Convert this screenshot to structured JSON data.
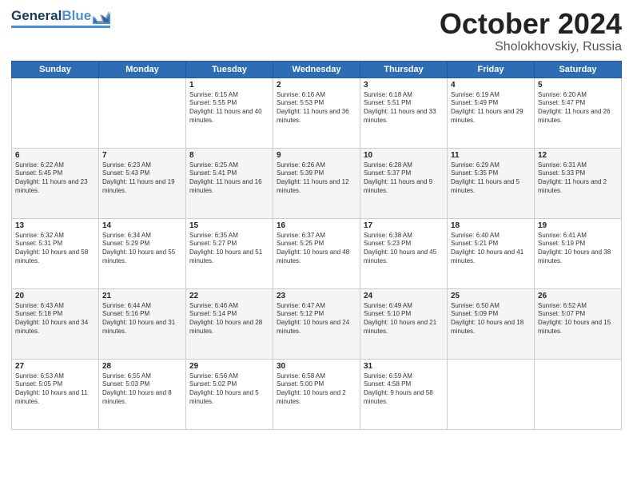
{
  "header": {
    "logo_general": "General",
    "logo_blue": "Blue",
    "title": "October 2024",
    "subtitle": "Sholokhovskiy, Russia"
  },
  "days_of_week": [
    "Sunday",
    "Monday",
    "Tuesday",
    "Wednesday",
    "Thursday",
    "Friday",
    "Saturday"
  ],
  "weeks": [
    [
      {
        "day": "",
        "sunrise": "",
        "sunset": "",
        "daylight": ""
      },
      {
        "day": "",
        "sunrise": "",
        "sunset": "",
        "daylight": ""
      },
      {
        "day": "1",
        "sunrise": "Sunrise: 6:15 AM",
        "sunset": "Sunset: 5:55 PM",
        "daylight": "Daylight: 11 hours and 40 minutes."
      },
      {
        "day": "2",
        "sunrise": "Sunrise: 6:16 AM",
        "sunset": "Sunset: 5:53 PM",
        "daylight": "Daylight: 11 hours and 36 minutes."
      },
      {
        "day": "3",
        "sunrise": "Sunrise: 6:18 AM",
        "sunset": "Sunset: 5:51 PM",
        "daylight": "Daylight: 11 hours and 33 minutes."
      },
      {
        "day": "4",
        "sunrise": "Sunrise: 6:19 AM",
        "sunset": "Sunset: 5:49 PM",
        "daylight": "Daylight: 11 hours and 29 minutes."
      },
      {
        "day": "5",
        "sunrise": "Sunrise: 6:20 AM",
        "sunset": "Sunset: 5:47 PM",
        "daylight": "Daylight: 11 hours and 26 minutes."
      }
    ],
    [
      {
        "day": "6",
        "sunrise": "Sunrise: 6:22 AM",
        "sunset": "Sunset: 5:45 PM",
        "daylight": "Daylight: 11 hours and 23 minutes."
      },
      {
        "day": "7",
        "sunrise": "Sunrise: 6:23 AM",
        "sunset": "Sunset: 5:43 PM",
        "daylight": "Daylight: 11 hours and 19 minutes."
      },
      {
        "day": "8",
        "sunrise": "Sunrise: 6:25 AM",
        "sunset": "Sunset: 5:41 PM",
        "daylight": "Daylight: 11 hours and 16 minutes."
      },
      {
        "day": "9",
        "sunrise": "Sunrise: 6:26 AM",
        "sunset": "Sunset: 5:39 PM",
        "daylight": "Daylight: 11 hours and 12 minutes."
      },
      {
        "day": "10",
        "sunrise": "Sunrise: 6:28 AM",
        "sunset": "Sunset: 5:37 PM",
        "daylight": "Daylight: 11 hours and 9 minutes."
      },
      {
        "day": "11",
        "sunrise": "Sunrise: 6:29 AM",
        "sunset": "Sunset: 5:35 PM",
        "daylight": "Daylight: 11 hours and 5 minutes."
      },
      {
        "day": "12",
        "sunrise": "Sunrise: 6:31 AM",
        "sunset": "Sunset: 5:33 PM",
        "daylight": "Daylight: 11 hours and 2 minutes."
      }
    ],
    [
      {
        "day": "13",
        "sunrise": "Sunrise: 6:32 AM",
        "sunset": "Sunset: 5:31 PM",
        "daylight": "Daylight: 10 hours and 58 minutes."
      },
      {
        "day": "14",
        "sunrise": "Sunrise: 6:34 AM",
        "sunset": "Sunset: 5:29 PM",
        "daylight": "Daylight: 10 hours and 55 minutes."
      },
      {
        "day": "15",
        "sunrise": "Sunrise: 6:35 AM",
        "sunset": "Sunset: 5:27 PM",
        "daylight": "Daylight: 10 hours and 51 minutes."
      },
      {
        "day": "16",
        "sunrise": "Sunrise: 6:37 AM",
        "sunset": "Sunset: 5:25 PM",
        "daylight": "Daylight: 10 hours and 48 minutes."
      },
      {
        "day": "17",
        "sunrise": "Sunrise: 6:38 AM",
        "sunset": "Sunset: 5:23 PM",
        "daylight": "Daylight: 10 hours and 45 minutes."
      },
      {
        "day": "18",
        "sunrise": "Sunrise: 6:40 AM",
        "sunset": "Sunset: 5:21 PM",
        "daylight": "Daylight: 10 hours and 41 minutes."
      },
      {
        "day": "19",
        "sunrise": "Sunrise: 6:41 AM",
        "sunset": "Sunset: 5:19 PM",
        "daylight": "Daylight: 10 hours and 38 minutes."
      }
    ],
    [
      {
        "day": "20",
        "sunrise": "Sunrise: 6:43 AM",
        "sunset": "Sunset: 5:18 PM",
        "daylight": "Daylight: 10 hours and 34 minutes."
      },
      {
        "day": "21",
        "sunrise": "Sunrise: 6:44 AM",
        "sunset": "Sunset: 5:16 PM",
        "daylight": "Daylight: 10 hours and 31 minutes."
      },
      {
        "day": "22",
        "sunrise": "Sunrise: 6:46 AM",
        "sunset": "Sunset: 5:14 PM",
        "daylight": "Daylight: 10 hours and 28 minutes."
      },
      {
        "day": "23",
        "sunrise": "Sunrise: 6:47 AM",
        "sunset": "Sunset: 5:12 PM",
        "daylight": "Daylight: 10 hours and 24 minutes."
      },
      {
        "day": "24",
        "sunrise": "Sunrise: 6:49 AM",
        "sunset": "Sunset: 5:10 PM",
        "daylight": "Daylight: 10 hours and 21 minutes."
      },
      {
        "day": "25",
        "sunrise": "Sunrise: 6:50 AM",
        "sunset": "Sunset: 5:09 PM",
        "daylight": "Daylight: 10 hours and 18 minutes."
      },
      {
        "day": "26",
        "sunrise": "Sunrise: 6:52 AM",
        "sunset": "Sunset: 5:07 PM",
        "daylight": "Daylight: 10 hours and 15 minutes."
      }
    ],
    [
      {
        "day": "27",
        "sunrise": "Sunrise: 6:53 AM",
        "sunset": "Sunset: 5:05 PM",
        "daylight": "Daylight: 10 hours and 11 minutes."
      },
      {
        "day": "28",
        "sunrise": "Sunrise: 6:55 AM",
        "sunset": "Sunset: 5:03 PM",
        "daylight": "Daylight: 10 hours and 8 minutes."
      },
      {
        "day": "29",
        "sunrise": "Sunrise: 6:56 AM",
        "sunset": "Sunset: 5:02 PM",
        "daylight": "Daylight: 10 hours and 5 minutes."
      },
      {
        "day": "30",
        "sunrise": "Sunrise: 6:58 AM",
        "sunset": "Sunset: 5:00 PM",
        "daylight": "Daylight: 10 hours and 2 minutes."
      },
      {
        "day": "31",
        "sunrise": "Sunrise: 6:59 AM",
        "sunset": "Sunset: 4:58 PM",
        "daylight": "Daylight: 9 hours and 58 minutes."
      },
      {
        "day": "",
        "sunrise": "",
        "sunset": "",
        "daylight": ""
      },
      {
        "day": "",
        "sunrise": "",
        "sunset": "",
        "daylight": ""
      }
    ]
  ]
}
